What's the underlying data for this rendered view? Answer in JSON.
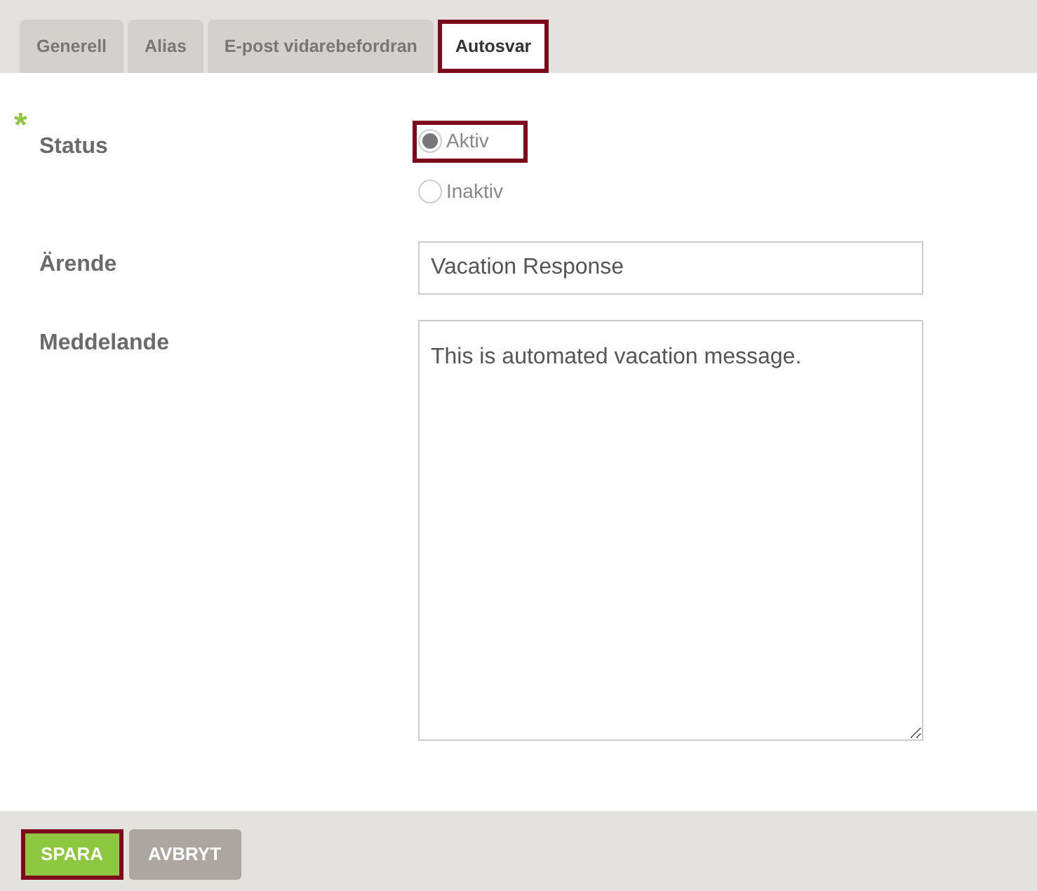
{
  "tabs": [
    {
      "label": "Generell",
      "selected": false,
      "highlighted": false
    },
    {
      "label": "Alias",
      "selected": false,
      "highlighted": false
    },
    {
      "label": "E-post vidarebefordran",
      "selected": false,
      "highlighted": false
    },
    {
      "label": "Autosvar",
      "selected": true,
      "highlighted": true
    }
  ],
  "status": {
    "label": "Status",
    "required_mark": "*",
    "options": [
      {
        "label": "Aktiv",
        "selected": true,
        "highlighted": true
      },
      {
        "label": "Inaktiv",
        "selected": false,
        "highlighted": false
      }
    ]
  },
  "subject": {
    "label": "Ärende",
    "value": "Vacation Response"
  },
  "message": {
    "label": "Meddelande",
    "value": "This is automated vacation message."
  },
  "buttons": [
    {
      "label": "SPARA",
      "kind": "primary",
      "highlighted": true
    },
    {
      "label": "AVBRYT",
      "kind": "secondary",
      "highlighted": false
    }
  ]
}
